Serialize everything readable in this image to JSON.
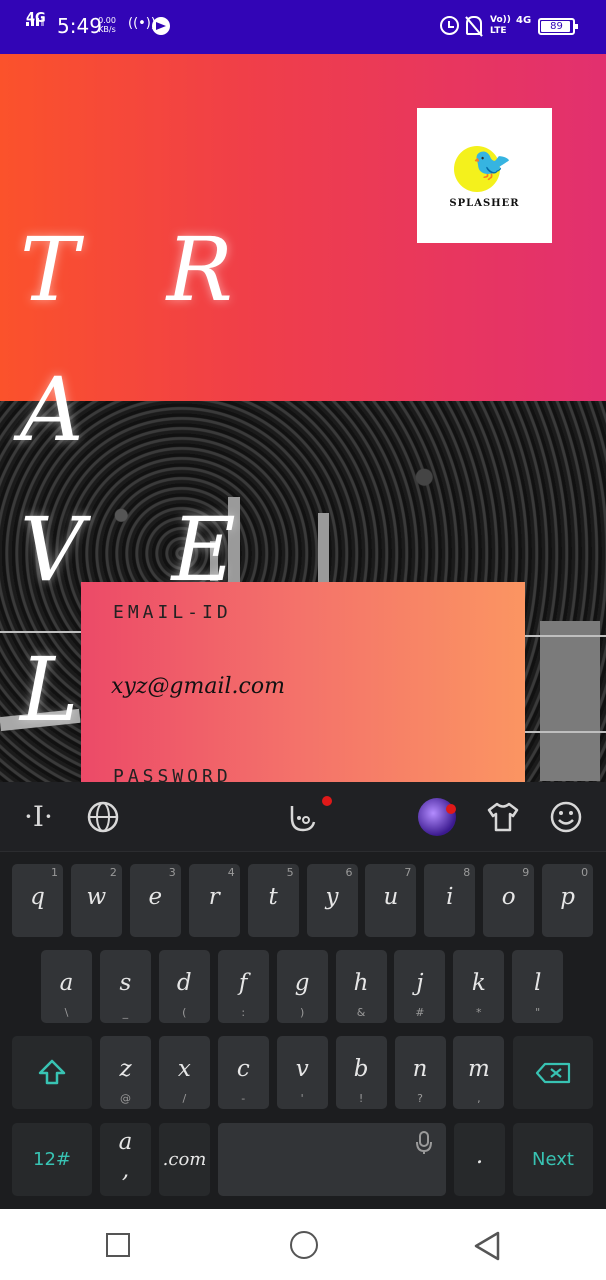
{
  "status_bar": {
    "network": "4G",
    "time": "5:49",
    "speed_value": "0.00",
    "speed_unit": "KB/s",
    "volte": "Vo)) LTE",
    "network2": "4G",
    "battery": "89",
    "battery_level": 0.89,
    "icons": [
      "signal-icon",
      "hotspot-icon",
      "telegram-icon",
      "alarm-icon",
      "mute-icon",
      "battery-icon"
    ]
  },
  "header": {
    "title_line1": "T R A",
    "title_line2": "V E L",
    "logo_text": "SPLASHER",
    "gradient_colors": [
      "#fb522b",
      "#e2306f"
    ]
  },
  "form": {
    "email_label": "EMAIL-ID",
    "email_value": "xyz@gmail.com",
    "password_label": "PASSWORD",
    "gradient_colors": [
      "#ec4a68",
      "#fb9562"
    ]
  },
  "keyboard": {
    "toolbar_icons": [
      "cursor-icon",
      "globe-icon",
      "voice-icon",
      "theme-icon",
      "shirt-icon",
      "emoji-icon"
    ],
    "row1": [
      {
        "key": "q",
        "sub": "1"
      },
      {
        "key": "w",
        "sub": "2"
      },
      {
        "key": "e",
        "sub": "3"
      },
      {
        "key": "r",
        "sub": "4"
      },
      {
        "key": "t",
        "sub": "5"
      },
      {
        "key": "y",
        "sub": "6"
      },
      {
        "key": "u",
        "sub": "7"
      },
      {
        "key": "i",
        "sub": "8"
      },
      {
        "key": "o",
        "sub": "9"
      },
      {
        "key": "p",
        "sub": "0"
      }
    ],
    "row2": [
      {
        "key": "a",
        "sub": "\\"
      },
      {
        "key": "s",
        "sub": "_"
      },
      {
        "key": "d",
        "sub": "("
      },
      {
        "key": "f",
        "sub": ":"
      },
      {
        "key": "g",
        "sub": ")"
      },
      {
        "key": "h",
        "sub": "&"
      },
      {
        "key": "j",
        "sub": "#"
      },
      {
        "key": "k",
        "sub": "*"
      },
      {
        "key": "l",
        "sub": "\""
      }
    ],
    "row3": [
      {
        "key": "z",
        "sub": "@"
      },
      {
        "key": "x",
        "sub": "/"
      },
      {
        "key": "c",
        "sub": "-"
      },
      {
        "key": "v",
        "sub": "'"
      },
      {
        "key": "b",
        "sub": "!"
      },
      {
        "key": "n",
        "sub": "?"
      },
      {
        "key": "m",
        "sub": ","
      }
    ],
    "num_key": "12#",
    "a_key": "a",
    "comma": ",",
    "com_key": ".com",
    "period_key": ".",
    "next_key": "Next"
  },
  "nav": {
    "icons": [
      "recents-icon",
      "home-icon",
      "back-icon"
    ]
  }
}
